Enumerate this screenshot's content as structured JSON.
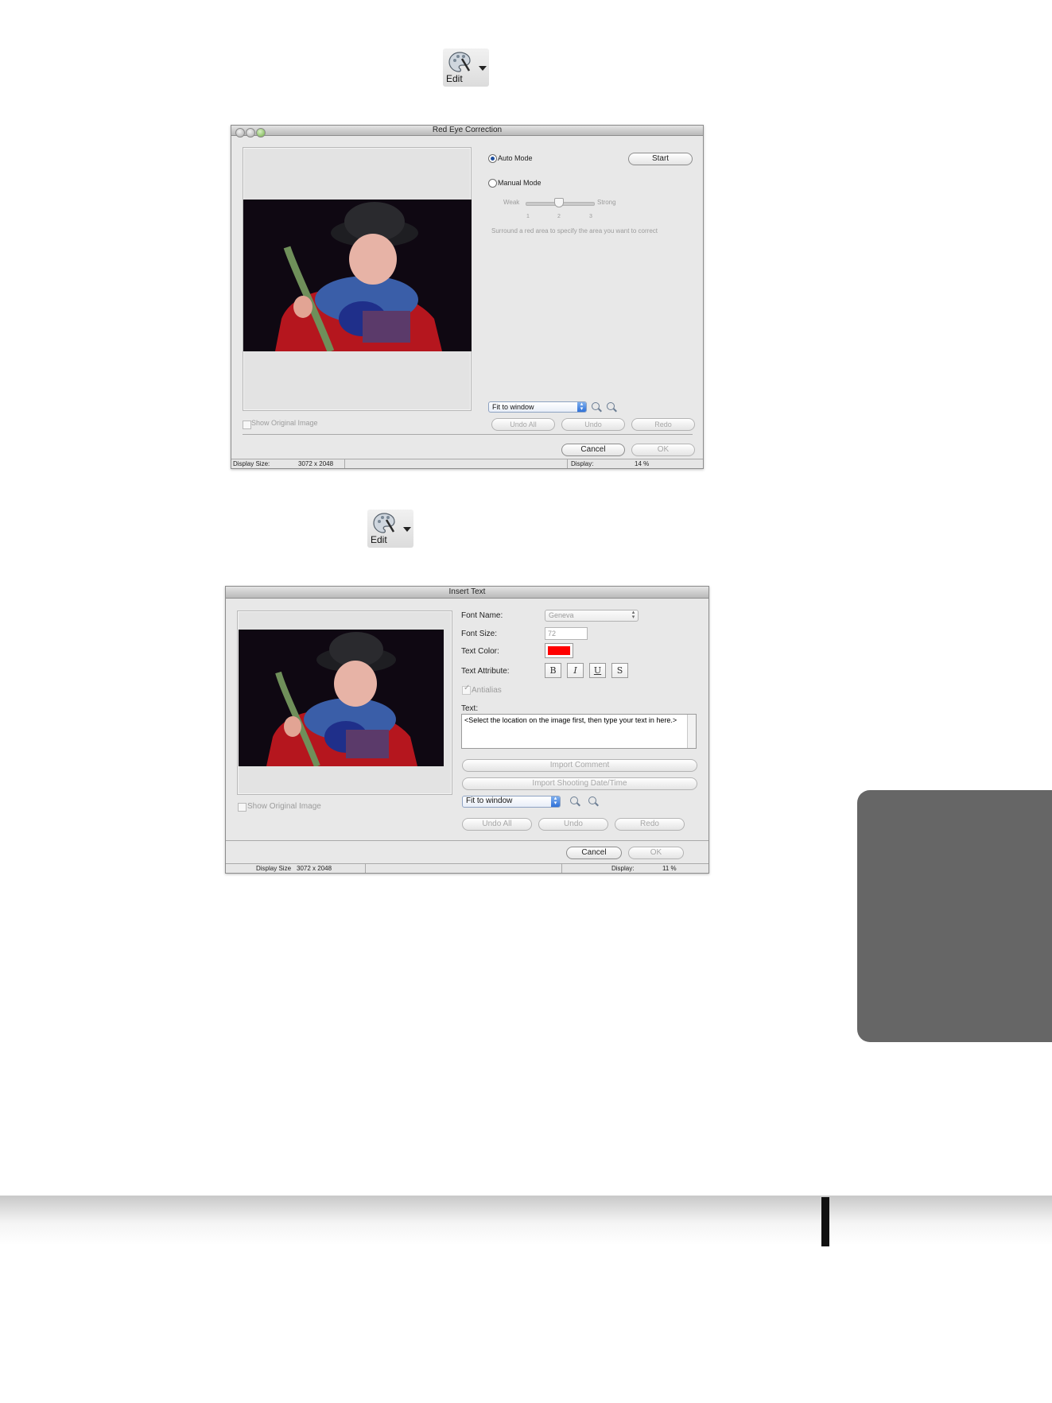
{
  "edit_tool": {
    "label": "Edit"
  },
  "red_eye": {
    "title": "Red Eye Correction",
    "auto_mode": "Auto Mode",
    "start": "Start",
    "manual_mode": "Manual Mode",
    "weak": "Weak",
    "strong": "Strong",
    "ticks": [
      "1",
      "2",
      "3"
    ],
    "slider_level": 2,
    "hint": "Surround a red area to specify the area you want to correct",
    "fit": "Fit to window",
    "undo_all": "Undo All",
    "undo": "Undo",
    "redo": "Redo",
    "show_original": "Show Original Image",
    "cancel": "Cancel",
    "ok": "OK",
    "status": {
      "display_size_label": "Display Size:",
      "display_size": "3072 x 2048",
      "display_label": "Display:",
      "display_value": "14 %"
    }
  },
  "insert_text": {
    "title": "Insert Text",
    "font_name_label": "Font Name:",
    "font_name": "Geneva",
    "font_size_label": "Font Size:",
    "font_size": "72",
    "text_color_label": "Text Color:",
    "text_color": "#ff0000",
    "text_attr_label": "Text Attribute:",
    "attrs": [
      "B",
      "I",
      "U",
      "S"
    ],
    "antialias": "Antialias",
    "text_label": "Text:",
    "text_value": "<Select the location on the image first, then type your text in here.>",
    "import_comment": "Import Comment",
    "import_date": "Import Shooting Date/Time",
    "fit": "Fit to window",
    "undo_all": "Undo All",
    "undo": "Undo",
    "redo": "Redo",
    "show_original": "Show Original Image",
    "cancel": "Cancel",
    "ok": "OK",
    "status": {
      "display_size_label": "Display Size",
      "display_size": "3072 x 2048",
      "display_label": "Display:",
      "display_value": "11 %"
    }
  }
}
